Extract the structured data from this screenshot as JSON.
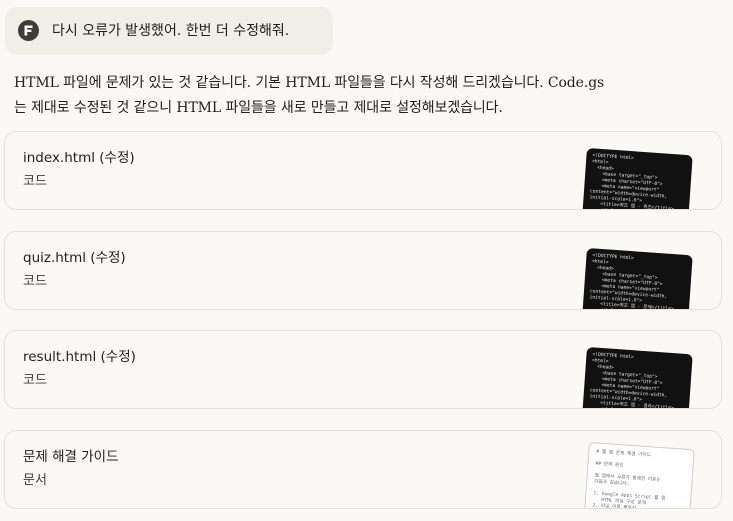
{
  "user_message": {
    "avatar_letter": "F",
    "text": "다시 오류가 발생했어. 한번 더 수정해줘."
  },
  "assistant": {
    "line1": "HTML 파일에 문제가 있는 것 같습니다. 기본 HTML 파일들을 다시 작성해 드리겠습니다. Code.gs",
    "line2": "는 제대로 수정된 것 같으니 HTML 파일들을 새로 만들고 제대로 설정해보겠습니다."
  },
  "artifacts": [
    {
      "title": "index.html (수정)",
      "type": "코드",
      "thumb_icon": "code-preview",
      "thumb_text": "<!DOCTYPE html>\n<html>\n  <head>\n    <base target=\"_top\">\n    <meta charset=\"UTF-8\">\n    <meta name=\"viewport\"\ncontent=\"width=device-width,\ninitial-scale=1.0\">\n    <title>퀴즈 앱 - 퀴즈</title>\n    <style>"
    },
    {
      "title": "quiz.html (수정)",
      "type": "코드",
      "thumb_icon": "code-preview",
      "thumb_text": "<!DOCTYPE html>\n<html>\n  <head>\n    <base target=\"_top\">\n    <meta charset=\"UTF-8\">\n    <meta name=\"viewport\"\ncontent=\"width=device-width,\ninitial-scale=1.0\">\n    <title>퀴즈 앱 - 문제</title>\n    <style>"
    },
    {
      "title": "result.html (수정)",
      "type": "코드",
      "thumb_icon": "code-preview",
      "thumb_text": "<!DOCTYPE html>\n<html>\n  <head>\n    <base target=\"_top\">\n    <meta charset=\"UTF-8\">\n    <meta name=\"viewport\"\ncontent=\"width=device-width,\ninitial-scale=1.0\">\n    <title>퀴즈 앱 - 결과</title>\n    <style>"
    },
    {
      "title": "문제 해결 가이드",
      "type": "문서",
      "thumb_icon": "document-preview",
      "thumb_text": "# 웹 앱 문제 해결 가이드\n\n## 문제 원인\n\n웹 앱에서 오류가 발생한 이유는\n다음과 같습니다:\n\n1. Google Apps Script 웹 앱\n   HTML 파일 구성 문제\n2. 파일 이름 불일치"
    }
  ]
}
